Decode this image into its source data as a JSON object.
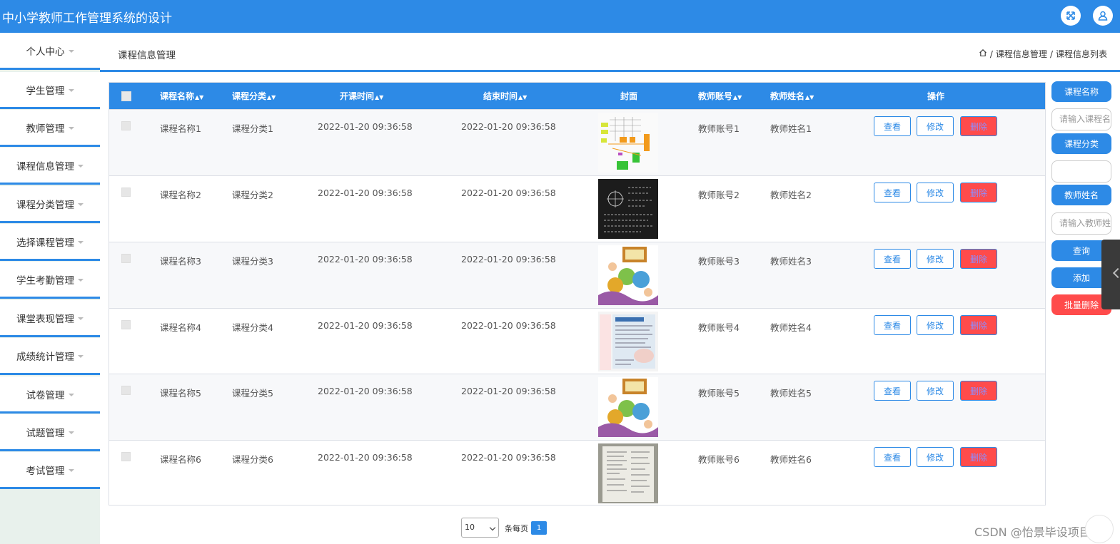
{
  "header": {
    "title": "中小学教师工作管理系统的设计",
    "icons": [
      "fullscreen-icon",
      "user-icon"
    ]
  },
  "sidebar": {
    "items": [
      {
        "label": "个人中心"
      },
      {
        "label": "学生管理"
      },
      {
        "label": "教师管理"
      },
      {
        "label": "课程信息管理"
      },
      {
        "label": "课程分类管理"
      },
      {
        "label": "选择课程管理"
      },
      {
        "label": "学生考勤管理"
      },
      {
        "label": "课堂表现管理"
      },
      {
        "label": "成绩统计管理"
      },
      {
        "label": "试卷管理"
      },
      {
        "label": "试题管理"
      },
      {
        "label": "考试管理"
      }
    ]
  },
  "breadcrumb": {
    "title": "课程信息管理",
    "separator": "/",
    "path": [
      "课程信息管理",
      "课程信息列表"
    ]
  },
  "table": {
    "columns": [
      "课程名称",
      "课程分类",
      "开课时间",
      "结束时间",
      "封面",
      "教师账号",
      "教师姓名",
      "操作"
    ],
    "actions": {
      "view": "查看",
      "edit": "修改",
      "delete": "删除"
    },
    "rows": [
      {
        "name": "课程名称1",
        "category": "课程分类1",
        "start": "2022-01-20 09:36:58",
        "end": "2022-01-20 09:36:58",
        "teacher_account": "教师账号1",
        "teacher_name": "教师姓名1",
        "cover": "diagram-thumbnail"
      },
      {
        "name": "课程名称2",
        "category": "课程分类2",
        "start": "2022-01-20 09:36:58",
        "end": "2022-01-20 09:36:58",
        "teacher_account": "教师账号2",
        "teacher_name": "教师姓名2",
        "cover": "chalkboard-thumbnail"
      },
      {
        "name": "课程名称3",
        "category": "课程分类3",
        "start": "2022-01-20 09:36:58",
        "end": "2022-01-20 09:36:58",
        "teacher_account": "教师账号3",
        "teacher_name": "教师姓名3",
        "cover": "english-kids-thumbnail"
      },
      {
        "name": "课程名称4",
        "category": "课程分类4",
        "start": "2022-01-20 09:36:58",
        "end": "2022-01-20 09:36:58",
        "teacher_account": "教师账号4",
        "teacher_name": "教师姓名4",
        "cover": "textbook-page-thumbnail"
      },
      {
        "name": "课程名称5",
        "category": "课程分类5",
        "start": "2022-01-20 09:36:58",
        "end": "2022-01-20 09:36:58",
        "teacher_account": "教师账号5",
        "teacher_name": "教师姓名5",
        "cover": "english-kids-thumbnail"
      },
      {
        "name": "课程名称6",
        "category": "课程分类6",
        "start": "2022-01-20 09:36:58",
        "end": "2022-01-20 09:36:58",
        "teacher_account": "教师账号6",
        "teacher_name": "教师姓名6",
        "cover": "notebook-thumbnail"
      }
    ]
  },
  "search": {
    "course_name_label": "课程名称",
    "course_name_placeholder": "请输入课程名称",
    "category_label": "课程分类",
    "category_value": "",
    "teacher_name_label": "教师姓名",
    "teacher_name_placeholder": "请输入教师姓名",
    "query_label": "查询",
    "add_label": "添加",
    "batch_delete_label": "批量删除"
  },
  "pagination": {
    "page_size": "10",
    "per_page_text": "条每页",
    "current_page": "1"
  },
  "watermark": "CSDN @怡景毕设项目",
  "colors": {
    "primary": "#2d8ae6",
    "danger": "#ff4b4b",
    "sidebar_bg": "#e8f1ec"
  }
}
